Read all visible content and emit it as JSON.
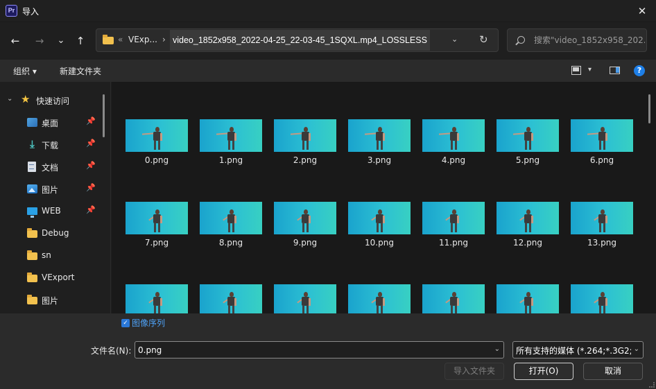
{
  "window": {
    "app_icon": "Pr",
    "title": "导入",
    "close_glyph": "✕"
  },
  "nav": {
    "back_glyph": "←",
    "forward_glyph": "→",
    "recent_glyph": "⌄",
    "up_glyph": "↑",
    "breadcrumb_overflow": "«",
    "breadcrumb": [
      "VExp...",
      "video_1852x958_2022-04-25_22-03-45_1SQXL.mp4_LOSSLESS"
    ],
    "breadcrumb_sep": "›",
    "dropdown_glyph": "⌄",
    "refresh_glyph": "↻",
    "search_placeholder": "搜索\"video_1852x958_202..."
  },
  "toolbar": {
    "organize": "组织 ▾",
    "new_folder": "新建文件夹",
    "view_drop_glyph": "▾",
    "help_glyph": "?"
  },
  "sidebar": {
    "quick_access": "快速访问",
    "chevron_glyph": "⌄",
    "star_glyph": "★",
    "pin_glyph": "📌",
    "download_glyph": "⤓",
    "items": [
      {
        "label": "桌面",
        "icon": "desktop-icon",
        "pinned": true
      },
      {
        "label": "下载",
        "icon": "download-icon",
        "pinned": true
      },
      {
        "label": "文档",
        "icon": "document-icon",
        "pinned": true
      },
      {
        "label": "图片",
        "icon": "pictures-icon",
        "pinned": true
      },
      {
        "label": "WEB",
        "icon": "monitor-icon",
        "pinned": true
      },
      {
        "label": "Debug",
        "icon": "folder-icon",
        "pinned": false
      },
      {
        "label": "sn",
        "icon": "folder-icon",
        "pinned": false
      },
      {
        "label": "VExport",
        "icon": "folder-icon",
        "pinned": false
      },
      {
        "label": "图片",
        "icon": "folder-icon",
        "pinned": false
      }
    ]
  },
  "files": [
    {
      "name": "0.png"
    },
    {
      "name": "1.png"
    },
    {
      "name": "2.png"
    },
    {
      "name": "3.png"
    },
    {
      "name": "4.png"
    },
    {
      "name": "5.png"
    },
    {
      "name": "6.png"
    },
    {
      "name": "7.png"
    },
    {
      "name": "8.png"
    },
    {
      "name": "9.png"
    },
    {
      "name": "10.png"
    },
    {
      "name": "11.png"
    },
    {
      "name": "12.png"
    },
    {
      "name": "13.png"
    },
    {
      "name": ""
    },
    {
      "name": ""
    },
    {
      "name": ""
    },
    {
      "name": ""
    },
    {
      "name": ""
    },
    {
      "name": ""
    },
    {
      "name": ""
    }
  ],
  "footer": {
    "image_sequence_label": "图像序列",
    "image_sequence_checked": true,
    "checkbox_glyph": "✓",
    "filename_label": "文件名(N):",
    "filename_value": "0.png",
    "dropdown_glyph": "⌄",
    "filetype_value": "所有支持的媒体 (*.264;*.3G2;*",
    "import_folder_button": "导入文件夹",
    "open_button": "打开(O)",
    "cancel_button": "取消"
  },
  "colors": {
    "accent": "#1e7fe8",
    "link": "#4ea1f5",
    "thumb_gradient_start": "#1aa3cd",
    "thumb_gradient_end": "#38d0c2"
  }
}
